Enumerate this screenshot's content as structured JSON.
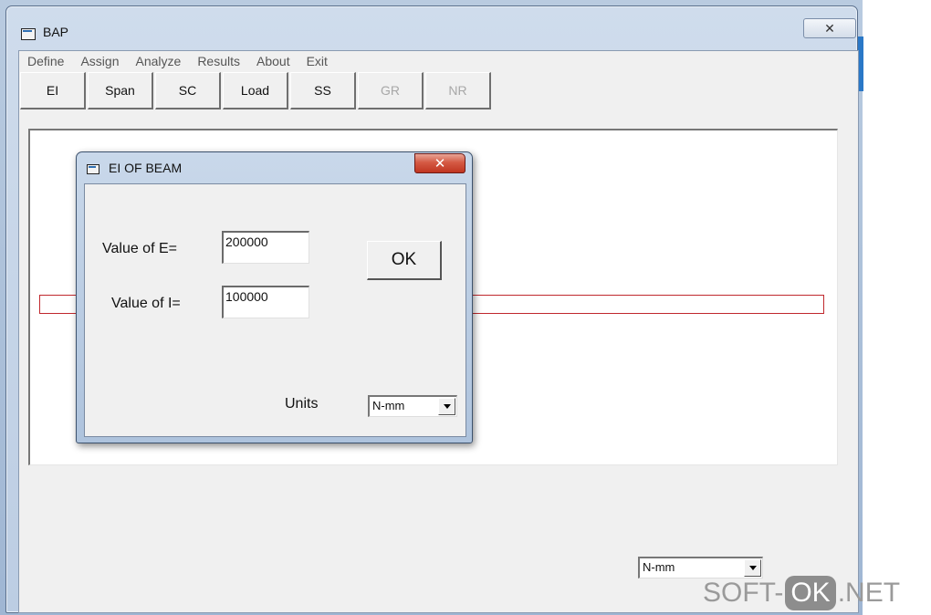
{
  "window": {
    "title": "BAP",
    "close_glyph": "✕"
  },
  "menu": [
    "Define",
    "Assign",
    "Analyze",
    "Results",
    "About",
    "Exit"
  ],
  "toolbar": [
    {
      "label": "EI",
      "enabled": true
    },
    {
      "label": "Span",
      "enabled": true
    },
    {
      "label": "SC",
      "enabled": true
    },
    {
      "label": "Load",
      "enabled": true
    },
    {
      "label": "SS",
      "enabled": true
    },
    {
      "label": "GR",
      "enabled": false
    },
    {
      "label": "NR",
      "enabled": false
    }
  ],
  "main_units": {
    "selected": "N-mm"
  },
  "dialog": {
    "title": "EI OF BEAM",
    "close_glyph": "✕",
    "e_label": "Value of E=",
    "e_value": "200000",
    "i_label": "Value of I=",
    "i_value": "100000",
    "ok_label": "OK",
    "units_label": "Units",
    "units_selected": "N-mm"
  },
  "watermark": {
    "left": "SOFT-",
    "pill": "OK",
    "right": ".NET"
  },
  "colors": {
    "beam_outline": "#c0282d",
    "dialog_close": "#c03521"
  }
}
